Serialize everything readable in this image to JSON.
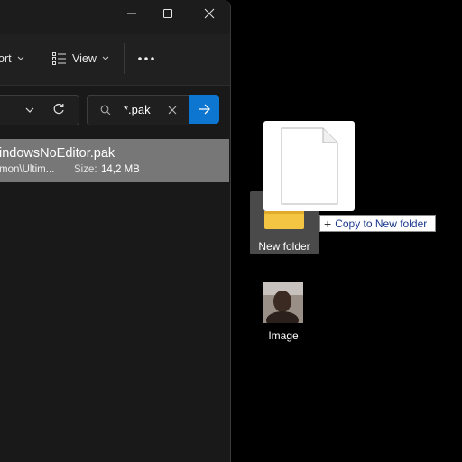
{
  "explorer": {
    "toolbar": {
      "sort_label": "ort",
      "view_label": "View"
    },
    "search": {
      "value": "*.pak"
    },
    "result": {
      "name": "indowsNoEditor.pak",
      "path": "mon\\Ultim...",
      "size_label": "Size:",
      "size_value": "14,2 MB"
    }
  },
  "desktop": {
    "folder_label": "New folder",
    "tooltip": {
      "text": "Copy to New folder"
    },
    "image_label": "Image"
  },
  "colors": {
    "accent": "#0c76d0",
    "selection": "#777777",
    "folder": "#f4c542"
  }
}
